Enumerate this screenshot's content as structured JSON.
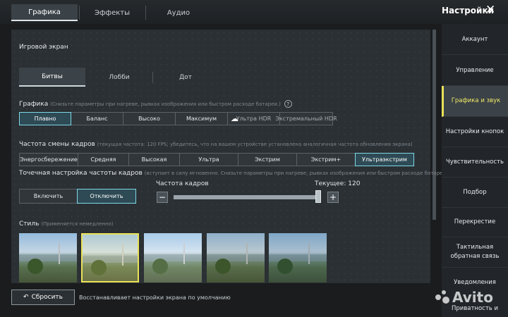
{
  "top_tabs": [
    "Графика",
    "Эффекты",
    "Аудио"
  ],
  "title": "Настройки",
  "close_glyph": "✕",
  "section_game_screen": "Игровой экран",
  "sub_tabs": [
    "Битвы",
    "Лобби",
    "Дот"
  ],
  "graphics": {
    "label": "Графика",
    "hint": "(Снизьте параметры при нагреве, рывках изображения или быстром расходе батареи.)",
    "options": [
      "Плавно",
      "Баланс",
      "Высоко",
      "Максимум",
      "Ультра HDR",
      "Экстремальный HDR"
    ],
    "selected": "Плавно"
  },
  "frame_rate": {
    "label": "Частота смены кадров",
    "hint": "(текущая частота: 120 FPS; убедитесь, что на вашем устройстве установлена аналогичная частота обновления экрана)",
    "options": [
      "Энергосбережение",
      "Средняя",
      "Высокая",
      "Ультра",
      "Экстрим",
      "Экстрим+",
      "Ультраэкстрим"
    ],
    "selected": "Ультраэкстрим"
  },
  "fine_tune": {
    "label": "Точечная настройка частоты кадров",
    "hint": "(вступает в силу мгновенно. Снизьте параметры при нагреве, рывках изображения или быстром расходе батареи.)",
    "options": [
      "Включить",
      "Отключить"
    ],
    "selected": "Отключить",
    "slider_label": "Частота кадров",
    "current_label": "Текущее: 120",
    "minus": "−",
    "plus": "+",
    "slider_value_fraction": 1.0
  },
  "style": {
    "label": "Стиль",
    "hint": "(Применяется немедленно)",
    "selected_index": 1,
    "count": 5
  },
  "reset": {
    "label": "Сбросить",
    "description": "Восстанавливает настройки экрана по умолчанию"
  },
  "sidebar": {
    "items": [
      "Аккаунт",
      "Управление",
      "Графика и звук",
      "Настройки кнопок",
      "Чувствительность",
      "Подбор",
      "Перекрестие",
      "Тактильная обратная связь",
      "Уведомления",
      "Приватность и"
    ],
    "active": "Графика и звук"
  },
  "watermark": "Avito",
  "colors": {
    "accent_cyan": "#7fd8e8",
    "accent_yellow": "#e8e15a"
  }
}
